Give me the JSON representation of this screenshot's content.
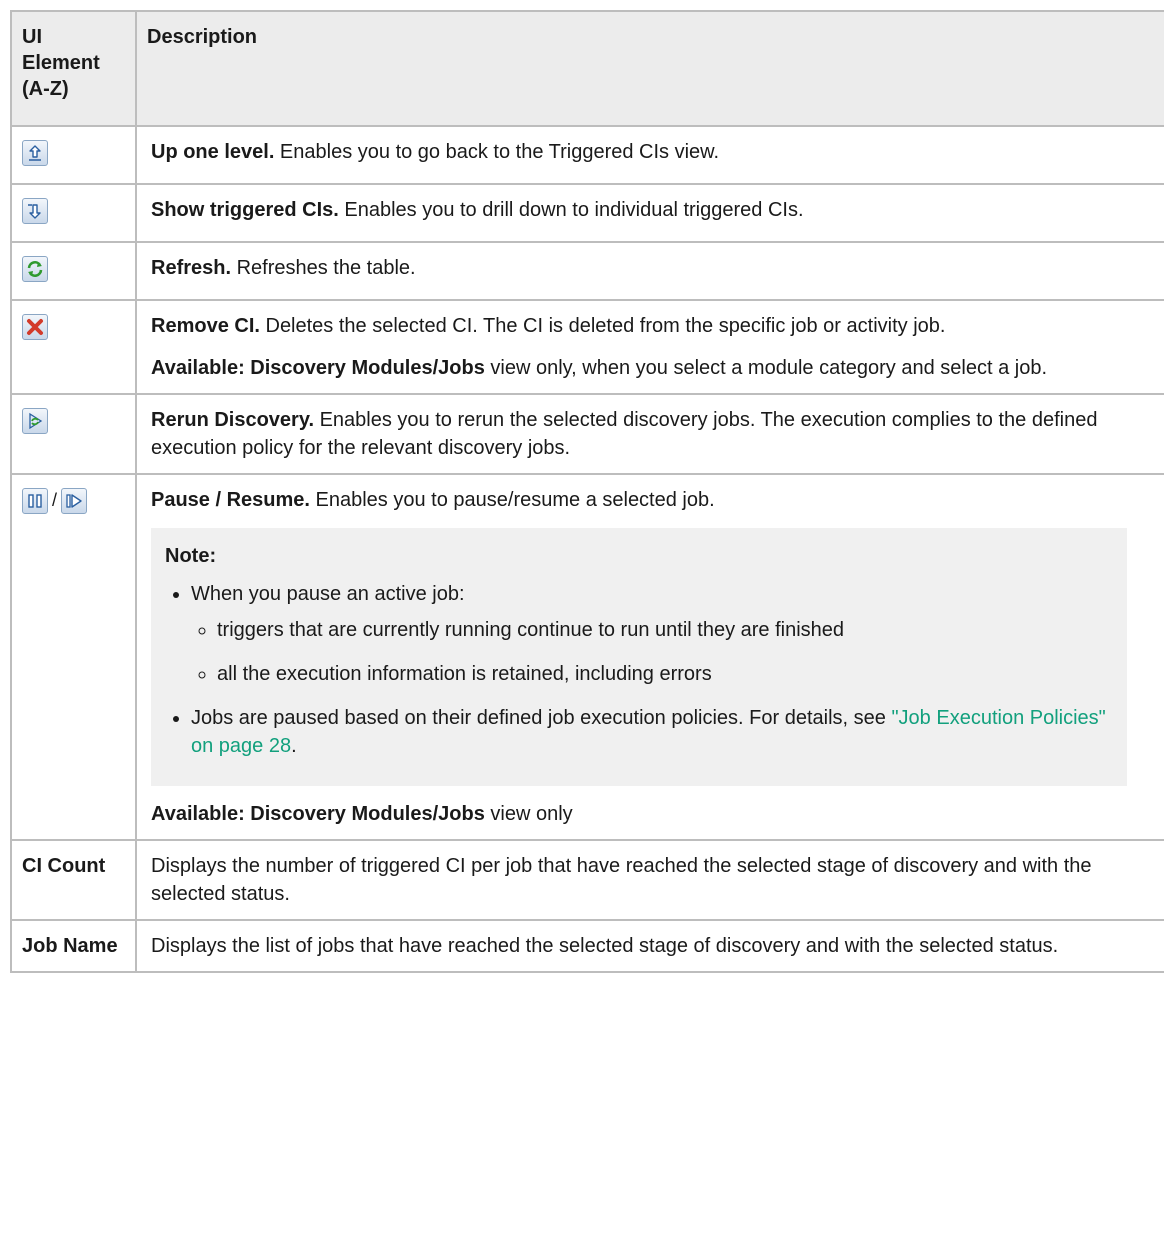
{
  "table": {
    "header": {
      "col1": "UI Element (A-Z)",
      "col2": "Description"
    },
    "rows": [
      {
        "icon": "up-one-level-icon",
        "title": "Up one level.",
        "text": " Enables you to go back to the Triggered CIs view."
      },
      {
        "icon": "show-triggered-cis-icon",
        "title": "Show triggered CIs.",
        "text": " Enables you to drill down to individual triggered CIs."
      },
      {
        "icon": "refresh-icon",
        "title": "Refresh.",
        "text": " Refreshes the table."
      },
      {
        "icon": "remove-ci-icon",
        "title": "Remove CI.",
        "text": " Deletes the selected CI. The CI is deleted from the specific job or activity job.",
        "avail_bold": "Available: Discovery Modules/Jobs",
        "avail_rest": " view only, when you select a module category and select a job."
      },
      {
        "icon": "rerun-discovery-icon",
        "title": "Rerun Discovery.",
        "text": " Enables you to rerun the selected discovery jobs. The execution complies to the defined execution policy for the relevant discovery jobs."
      },
      {
        "icons": [
          "pause-icon",
          "resume-icon"
        ],
        "separator": "/",
        "title": "Pause / Resume.",
        "text": " Enables you to pause/resume a selected job.",
        "note": {
          "title": "Note:",
          "items": [
            {
              "text": "When you pause an active job:",
              "subitems": [
                "triggers that are currently running continue to run until they are finished",
                "all the execution information is retained, including errors"
              ]
            },
            {
              "text": "Jobs are paused based on their defined job execution policies. For details, see ",
              "link": "\"Job Execution Policies\" on page 28",
              "after": "."
            }
          ]
        },
        "avail_bold": "Available: Discovery Modules/Jobs",
        "avail_rest": " view only"
      },
      {
        "label": "CI Count",
        "text": "Displays the number of triggered CI per job that have reached the selected stage of discovery and with the selected status."
      },
      {
        "label": "Job Name",
        "text": "Displays the list of jobs that have reached the selected stage of discovery and with the selected status."
      }
    ]
  },
  "colors": {
    "border": "#bdbdbd",
    "header_bg": "#ececec",
    "note_bg": "#f0f0f0",
    "link": "#12a07d"
  }
}
